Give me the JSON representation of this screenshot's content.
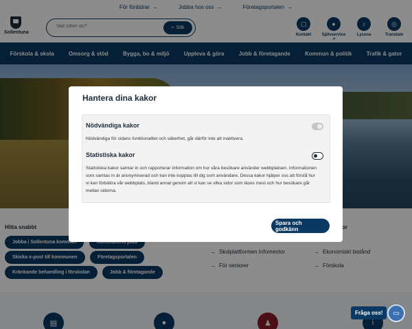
{
  "toplinks": [
    {
      "label": "För föräldrar"
    },
    {
      "label": "Jobba hos oss"
    },
    {
      "label": "Företagsportalen"
    }
  ],
  "logo": {
    "name": "Sollentuna"
  },
  "search": {
    "placeholder": "Vad söker du?",
    "button": "Sök"
  },
  "header_icons": [
    {
      "label": "Kontakt",
      "icon": "chat-icon"
    },
    {
      "label": "Självservice",
      "icon": "person-icon"
    },
    {
      "label": "Lyssna",
      "icon": "audio-icon"
    },
    {
      "label": "Translate",
      "icon": "globe-icon"
    }
  ],
  "nav": [
    "Förskola & skola",
    "Omsorg & stöd",
    "Bygga, bo & miljö",
    "Uppleva & göra",
    "Jobb & företagande",
    "Kommun & politik",
    "Trafik & gator"
  ],
  "quick": {
    "title": "Hitta snabbt",
    "pills": [
      "Jobba i Sollentuna kommun",
      "Kommunens jobb",
      "Skicka e-post till kommunen",
      "Företagsportalen",
      "Kränkande behandling i förskolan",
      "Jobb & företagande"
    ]
  },
  "mid_links": [
    "Skolplattformen Infomentor",
    "För seniorer"
  ],
  "right": {
    "title_fragment": "or",
    "links": [
      "Ekonomiskt bistånd",
      "Förskola"
    ]
  },
  "modal": {
    "title": "Hantera dina kakor",
    "necessary": {
      "title": "Nödvändiga kakor",
      "text": "Nödvändiga för sidans funktionalitet och säkerhet, går därför inte att inaktivera.",
      "state": "on-locked"
    },
    "statistics": {
      "title": "Statistiska kakor",
      "text": "Statistiska kakor samlar in och rapporterar information om hur våra besökare använder webbplatsen. Informationen som samlas in är anonymiserad och kan inte kopplas till dig som användare. Dessa kakor hjälper oss att förstå hur vi kan förbättra vår webbplats, bland annat genom att vi kan se vilka sidor som läses mest och hur besökare går mellan sidorna.",
      "state": "off"
    },
    "save_button": "Spara och godkänn"
  },
  "chat": {
    "label": "Fråga oss!"
  },
  "colors": {
    "brand": "#0a3a63",
    "overlay": "rgba(0,0,0,0.45)"
  }
}
